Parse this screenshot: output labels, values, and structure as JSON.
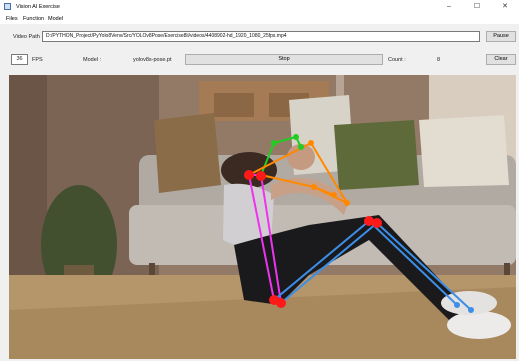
{
  "window": {
    "title": "Vision AI Exercise",
    "controls": {
      "minimize": "–",
      "maximize": "☐",
      "close": "✕"
    }
  },
  "menu": {
    "items": [
      "Files",
      "Function",
      "Model"
    ]
  },
  "video": {
    "label": "Video Path",
    "path": "D:/PYTHON_Project/PyYolo8Venv/Src/YOLOv8Pose/Exercise8li/videos/4408902-hd_1920_1080_25fps.mp4",
    "pause_label": "Pause"
  },
  "status": {
    "fps_value": "36",
    "fps_label": "FPS",
    "model_label": "Model :",
    "model_value": "yolov8s-pose.pt",
    "stop_label": "Stop",
    "count_label": "Count :",
    "count_value": "8",
    "clear_label": "Clear"
  },
  "skeleton_colors": {
    "head": "#22cc22",
    "arms": "#ff8800",
    "torso": "#ee33ee",
    "legs": "#3b8fe8",
    "keypoints": "#ff1a1a"
  }
}
